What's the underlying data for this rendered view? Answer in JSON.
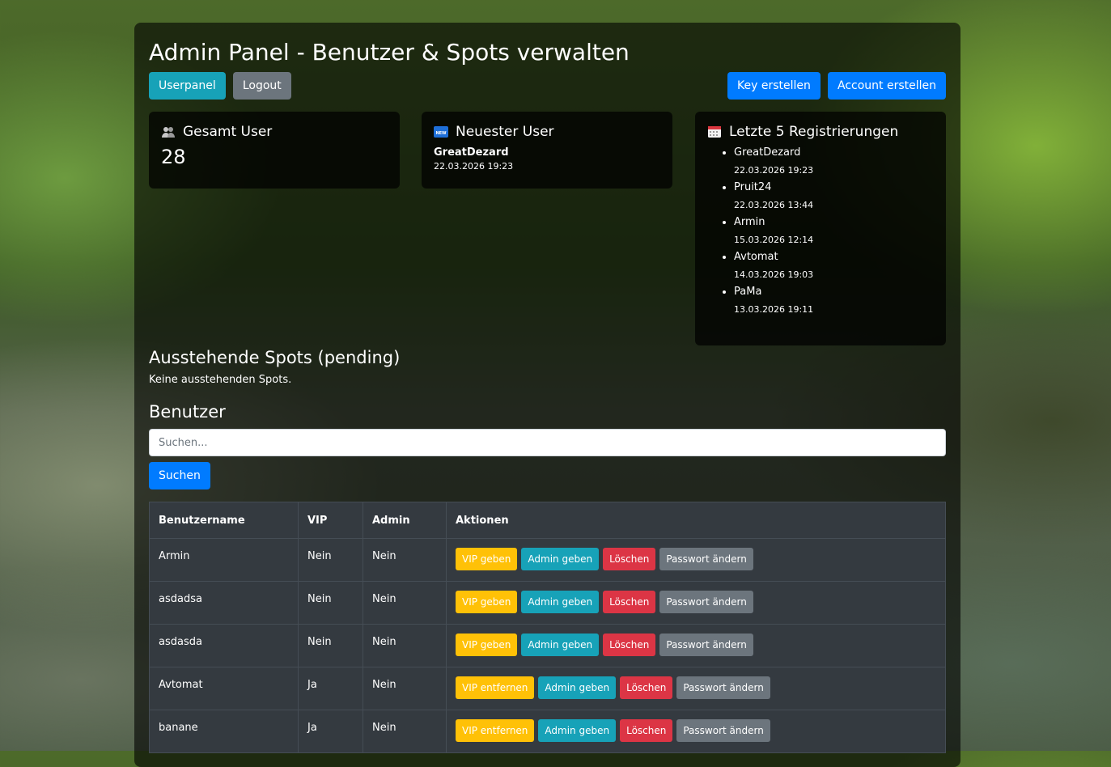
{
  "header": {
    "title": "Admin Panel - Benutzer & Spots verwalten",
    "buttons_left": [
      {
        "label": "Userpanel",
        "variant": "info"
      },
      {
        "label": "Logout",
        "variant": "secondary"
      }
    ],
    "buttons_right": [
      {
        "label": "Key erstellen",
        "variant": "primary"
      },
      {
        "label": "Account erstellen",
        "variant": "primary"
      }
    ]
  },
  "stats": {
    "total": {
      "icon": "users-icon",
      "title": "Gesamt User",
      "value": "28"
    },
    "newest": {
      "icon": "new-icon",
      "title": "Neuester User",
      "name": "GreatDezard",
      "date": "22.03.2026 19:23"
    },
    "latest": {
      "icon": "calendar-icon",
      "title": "Letzte 5 Registrierungen",
      "items": [
        {
          "name": "GreatDezard",
          "date": "22.03.2026 19:23"
        },
        {
          "name": "Pruit24",
          "date": "22.03.2026 13:44"
        },
        {
          "name": "Armin",
          "date": "15.03.2026 12:14"
        },
        {
          "name": "Avtomat",
          "date": "14.03.2026 19:03"
        },
        {
          "name": "PaMa",
          "date": "13.03.2026 19:11"
        }
      ]
    }
  },
  "pending": {
    "title": "Ausstehende Spots (pending)",
    "empty_text": "Keine ausstehenden Spots."
  },
  "users": {
    "title": "Benutzer",
    "search_placeholder": "Suchen...",
    "search_button": "Suchen",
    "columns": [
      "Benutzername",
      "VIP",
      "Admin",
      "Aktionen"
    ],
    "rows": [
      {
        "name": "Armin",
        "vip": "Nein",
        "admin": "Nein",
        "actions": [
          "VIP geben",
          "Admin geben",
          "Löschen",
          "Passwort ändern"
        ]
      },
      {
        "name": "asdadsa",
        "vip": "Nein",
        "admin": "Nein",
        "actions": [
          "VIP geben",
          "Admin geben",
          "Löschen",
          "Passwort ändern"
        ]
      },
      {
        "name": "asdasda",
        "vip": "Nein",
        "admin": "Nein",
        "actions": [
          "VIP geben",
          "Admin geben",
          "Löschen",
          "Passwort ändern"
        ]
      },
      {
        "name": "Avtomat",
        "vip": "Ja",
        "admin": "Nein",
        "actions": [
          "VIP entfernen",
          "Admin geben",
          "Löschen",
          "Passwort ändern"
        ]
      },
      {
        "name": "banane",
        "vip": "Ja",
        "admin": "Nein",
        "actions": [
          "VIP entfernen",
          "Admin geben",
          "Löschen",
          "Passwort ändern"
        ]
      }
    ]
  },
  "colors": {
    "info": "#17a2b8",
    "secondary": "#6c757d",
    "primary": "#007bff",
    "warning": "#ffc107",
    "danger": "#dc3545",
    "table_bg": "#343a40"
  }
}
